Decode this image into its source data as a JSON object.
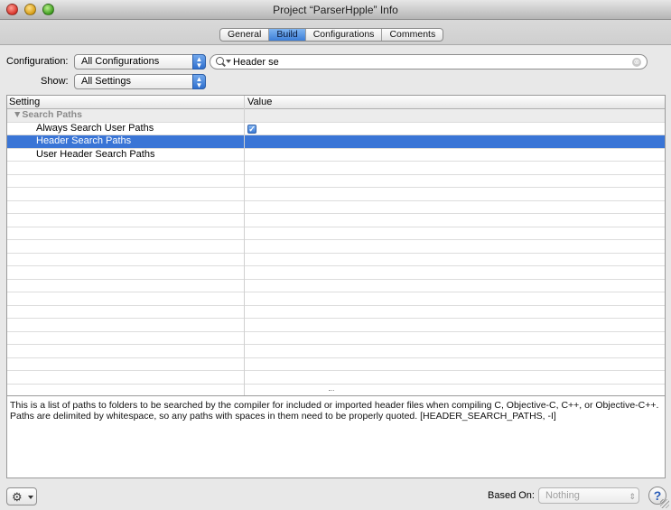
{
  "window": {
    "title": "Project “ParserHpple” Info"
  },
  "tabs": [
    {
      "label": "General",
      "selected": false
    },
    {
      "label": "Build",
      "selected": true
    },
    {
      "label": "Configurations",
      "selected": false
    },
    {
      "label": "Comments",
      "selected": false
    }
  ],
  "configuration": {
    "label": "Configuration:",
    "value": "All Configurations"
  },
  "show": {
    "label": "Show:",
    "value": "All Settings"
  },
  "search": {
    "value": "Header se"
  },
  "table": {
    "headers": {
      "setting": "Setting",
      "value": "Value"
    },
    "group": "▼Search Paths",
    "rows": [
      {
        "setting": "Always Search User Paths",
        "value": "checked",
        "selected": false
      },
      {
        "setting": "Header Search Paths",
        "value": "",
        "selected": true
      },
      {
        "setting": "User Header Search Paths",
        "value": "",
        "selected": false
      }
    ]
  },
  "description": "This is a list of paths to folders to be searched by the compiler for included or imported header files when compiling C, Objective-C, C++, or Objective-C++. Paths are delimited by whitespace, so any paths with spaces in them need to be properly quoted. [HEADER_SEARCH_PATHS, -I]",
  "footer": {
    "based_on_label": "Based On:",
    "based_on_value": "Nothing",
    "help": "?"
  },
  "icons": {
    "gear": "⚙",
    "search": "magnifier-icon",
    "clear": "⊗"
  },
  "colors": {
    "selection": "#3a75d6",
    "tab_selected": "#3d7fd8",
    "group_text": "#8a8a8a"
  }
}
